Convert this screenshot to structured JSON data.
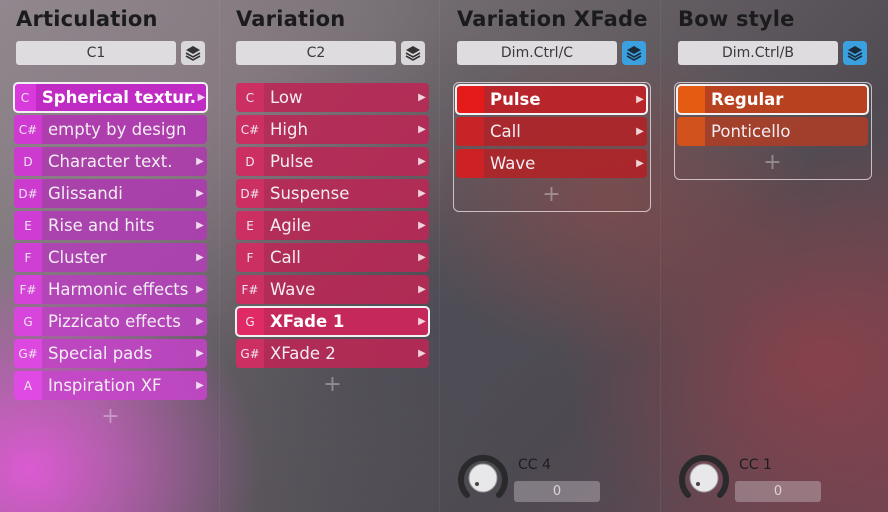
{
  "columns": [
    {
      "title": "Articulation",
      "selector": "C1",
      "layer_icon": "layers-icon",
      "items": [
        {
          "key": "C",
          "label": "Spherical textur.",
          "selected": true
        },
        {
          "key": "C#",
          "label": "empty by design"
        },
        {
          "key": "D",
          "label": "Character text."
        },
        {
          "key": "D#",
          "label": "Glissandi"
        },
        {
          "key": "E",
          "label": "Rise and hits"
        },
        {
          "key": "F",
          "label": "Cluster"
        },
        {
          "key": "F#",
          "label": "Harmonic effects"
        },
        {
          "key": "G",
          "label": "Pizzicato effects"
        },
        {
          "key": "G#",
          "label": "Special pads"
        },
        {
          "key": "A",
          "label": "Inspiration XF"
        }
      ],
      "add_label": "+"
    },
    {
      "title": "Variation",
      "selector": "C2",
      "layer_icon": "layers-icon",
      "items": [
        {
          "key": "C",
          "label": "Low"
        },
        {
          "key": "C#",
          "label": "High"
        },
        {
          "key": "D",
          "label": "Pulse"
        },
        {
          "key": "D#",
          "label": "Suspense"
        },
        {
          "key": "E",
          "label": "Agile"
        },
        {
          "key": "F",
          "label": "Call"
        },
        {
          "key": "F#",
          "label": "Wave"
        },
        {
          "key": "G",
          "label": "XFade 1",
          "selected": true
        },
        {
          "key": "G#",
          "label": "XFade 2"
        }
      ],
      "add_label": "+"
    },
    {
      "title": "Variation XFade",
      "selector": "Dim.Ctrl/C",
      "layer_icon": "layers-icon",
      "items": [
        {
          "label": "Pulse",
          "selected": true
        },
        {
          "label": "Call"
        },
        {
          "label": "Wave"
        }
      ],
      "add_label": "+",
      "cc_label": "CC 4",
      "cc_value": "0"
    },
    {
      "title": "Bow style",
      "selector": "Dim.Ctrl/B",
      "layer_icon": "layers-icon",
      "items": [
        {
          "label": "Regular",
          "selected": true
        },
        {
          "label": "Ponticello"
        }
      ],
      "add_label": "+",
      "cc_label": "CC 1",
      "cc_value": "0"
    }
  ],
  "colors": {
    "articulation": "#c42ac8",
    "articulation_key": "#d83adb",
    "variation": "#c02a5a",
    "variation_key": "#d02f62",
    "xfade": "#b82428",
    "xfade_key": "#e51b1b",
    "bow": "#b8401e",
    "bow_key": "#e65b12",
    "layer_active": "#3aa0e0"
  }
}
